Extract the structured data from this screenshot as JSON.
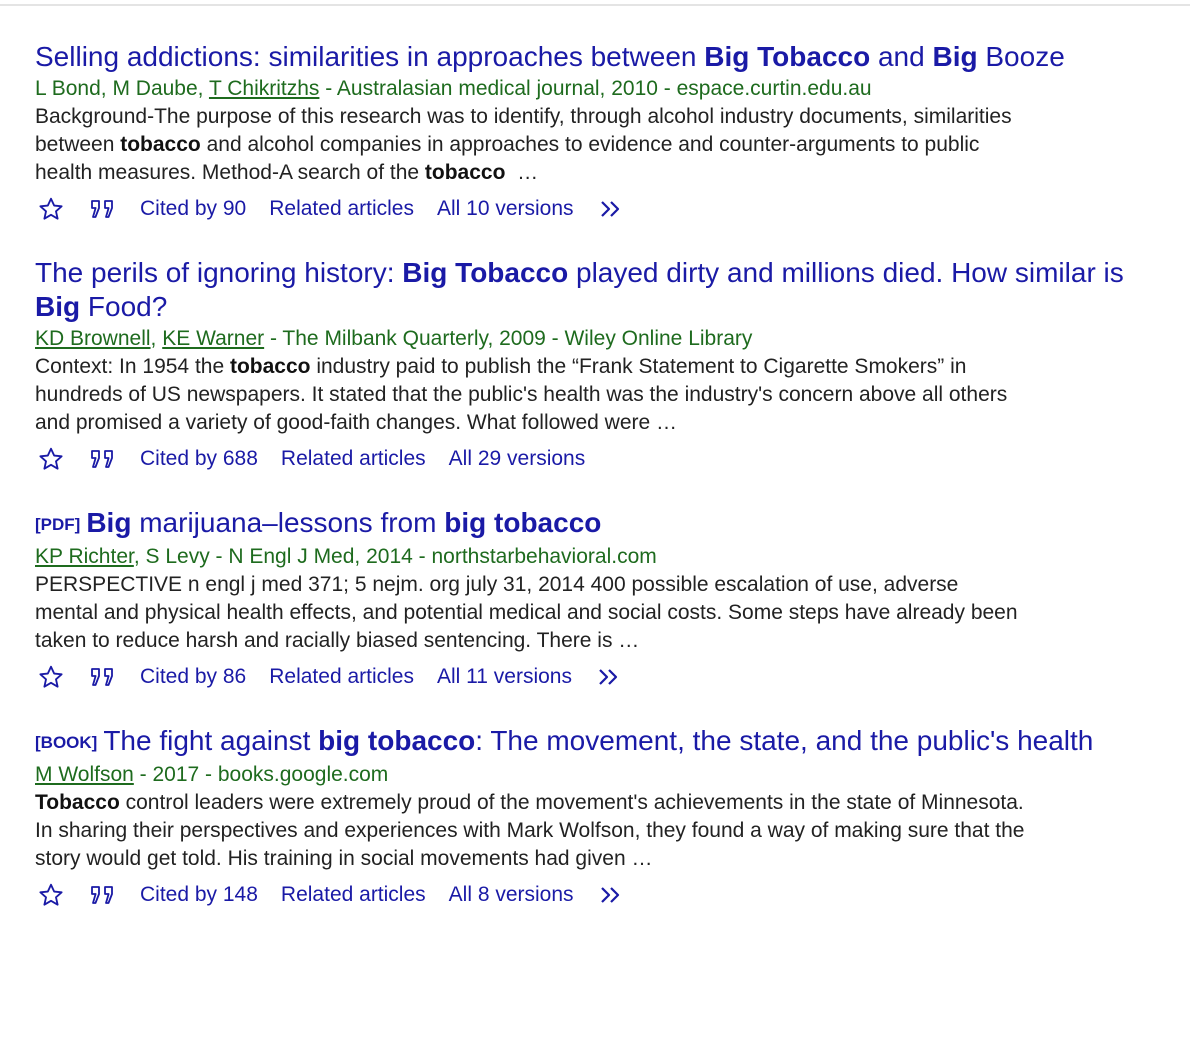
{
  "results": [
    {
      "title_parts": [
        "Selling addictions: similarities in approaches between ",
        "Big Tobacco",
        " and ",
        "Big",
        " Booze"
      ],
      "authors_plain": "L Bond, M Daube, ",
      "authors_linked": [
        "T Chikritzhs"
      ],
      "source": " - Australasian medical journal, 2010 - espace.curtin.edu.au",
      "snippet_parts": [
        "Background-The purpose of this research was to identify, through alcohol industry documents, similarities between ",
        "tobacco",
        " and alcohol companies in approaches to evidence and counter-arguments to public health measures. Method-A search of the ",
        "tobacco",
        "  …"
      ],
      "cited_by": "Cited by 90",
      "related": "Related articles",
      "versions": "All 10 versions"
    },
    {
      "title_parts": [
        "The perils of ignoring history: ",
        "Big Tobacco",
        " played dirty and millions died. How similar is ",
        "Big",
        " Food?"
      ],
      "authors_linked": [
        "KD Brownell",
        "KE Warner"
      ],
      "source": " - The Milbank Quarterly, 2009 - Wiley Online Library",
      "snippet_parts": [
        "Context: In 1954 the ",
        "tobacco",
        " industry paid to publish the “Frank Statement to Cigarette Smokers” in hundreds of US newspapers. It stated that the public's health was the industry's concern above all others and promised a variety of good-faith changes. What followed were …"
      ],
      "cited_by": "Cited by 688",
      "related": "Related articles",
      "versions": "All 29 versions"
    },
    {
      "type_tag": "[PDF]",
      "title_parts": [
        "Big",
        " marijuana–lessons from ",
        "big tobacco"
      ],
      "authors_linked": [
        "KP Richter"
      ],
      "authors_tail": ", S Levy",
      "source": " - N Engl J Med, 2014 - northstarbehavioral.com",
      "snippet_parts": [
        "PERSPECTIVE n engl j med 371; 5 nejm. org july 31, 2014 400 possible escalation of use, adverse mental and physical health effects, and potential medical and social costs. Some steps have already been taken to reduce harsh and racially biased sentencing. There is …"
      ],
      "cited_by": "Cited by 86",
      "related": "Related articles",
      "versions": "All 11 versions"
    },
    {
      "type_tag": "[BOOK]",
      "title_parts": [
        "The fight against ",
        "big tobacco",
        ": The movement, the state, and the public's health"
      ],
      "authors_linked": [
        "M Wolfson"
      ],
      "source": " - 2017 - books.google.com",
      "snippet_parts": [
        "Tobacco",
        " control leaders were extremely proud of the movement's achievements in the state of Minnesota. In sharing their perspectives and experiences with Mark Wolfson, they found a way of making sure that the story would get told. His training in social movements had given …"
      ],
      "cited_by": "Cited by 148",
      "related": "Related articles",
      "versions": "All 8 versions"
    }
  ],
  "icons": {
    "save": "star-icon",
    "cite": "quote-icon",
    "more": "double-chevron-right-icon"
  },
  "colors": {
    "title": "#1a1aa6",
    "meta": "#1e6b1e",
    "snippet": "#222222"
  }
}
